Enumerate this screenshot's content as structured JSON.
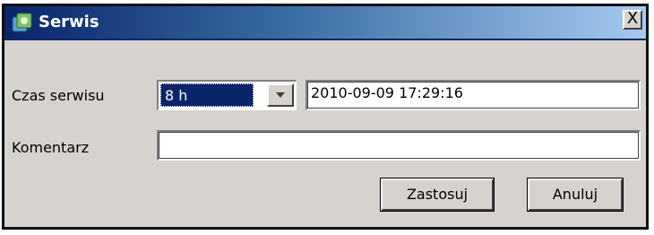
{
  "window": {
    "title": "Serwis",
    "close_label": "X",
    "icon": "app-icon"
  },
  "form": {
    "service_time_label": "Czas serwisu",
    "service_time_value": "8 h",
    "datetime_value": "2010-09-09 17:29:16",
    "comment_label": "Komentarz",
    "comment_value": ""
  },
  "buttons": {
    "apply_label": "Zastosuj",
    "cancel_label": "Anuluj"
  },
  "colors": {
    "titlebar_start": "#0a246a",
    "titlebar_end": "#a6caf0",
    "window_bg": "#d6d3ce",
    "selection": "#0a246a"
  }
}
